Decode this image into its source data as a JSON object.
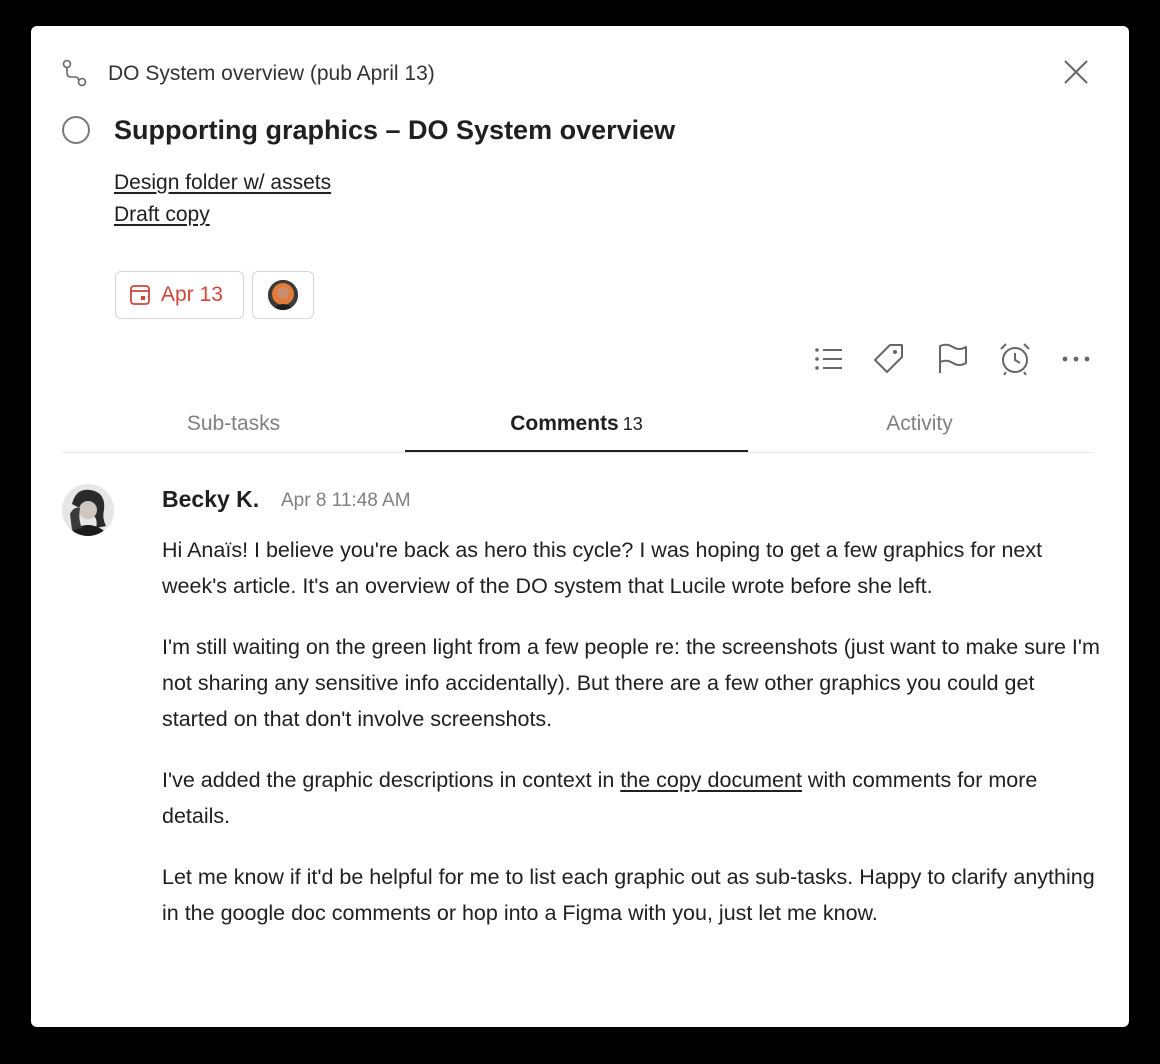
{
  "breadcrumb": {
    "project": "DO System overview (pub April 13)"
  },
  "task": {
    "title": "Supporting graphics – DO System overview",
    "links": [
      "Design folder w/ assets",
      "Draft copy"
    ],
    "due_date": "Apr 13",
    "due_color": "#d1453b"
  },
  "toolbar": {
    "icons": [
      "subtasks-list-icon",
      "label-icon",
      "flag-icon",
      "alarm-icon",
      "more-icon"
    ]
  },
  "tabs": [
    {
      "label": "Sub-tasks"
    },
    {
      "label": "Comments",
      "count": "13"
    },
    {
      "label": "Activity"
    }
  ],
  "comment": {
    "author": "Becky K.",
    "timestamp": "Apr 8 11:48 AM",
    "paragraphs": {
      "p1": "Hi Anaïs! I believe you're back as hero this cycle? I was hoping to get a few graphics for next week's article. It's an overview of the DO system that Lucile wrote before she left.",
      "p2": "I'm still waiting on the green light from a few people re: the screenshots (just want to make sure I'm not sharing any sensitive info accidentally). But there are a few other graphics you could get started on that don't involve screenshots.",
      "p3_before": "I've added the graphic descriptions in context in ",
      "p3_link": "the copy document",
      "p3_after": " with comments for more details.",
      "p4": "Let me know if it'd be helpful for me to list each graphic out as sub-tasks. Happy to clarify anything in the google doc comments or hop into a Figma with you, just let me know."
    }
  }
}
